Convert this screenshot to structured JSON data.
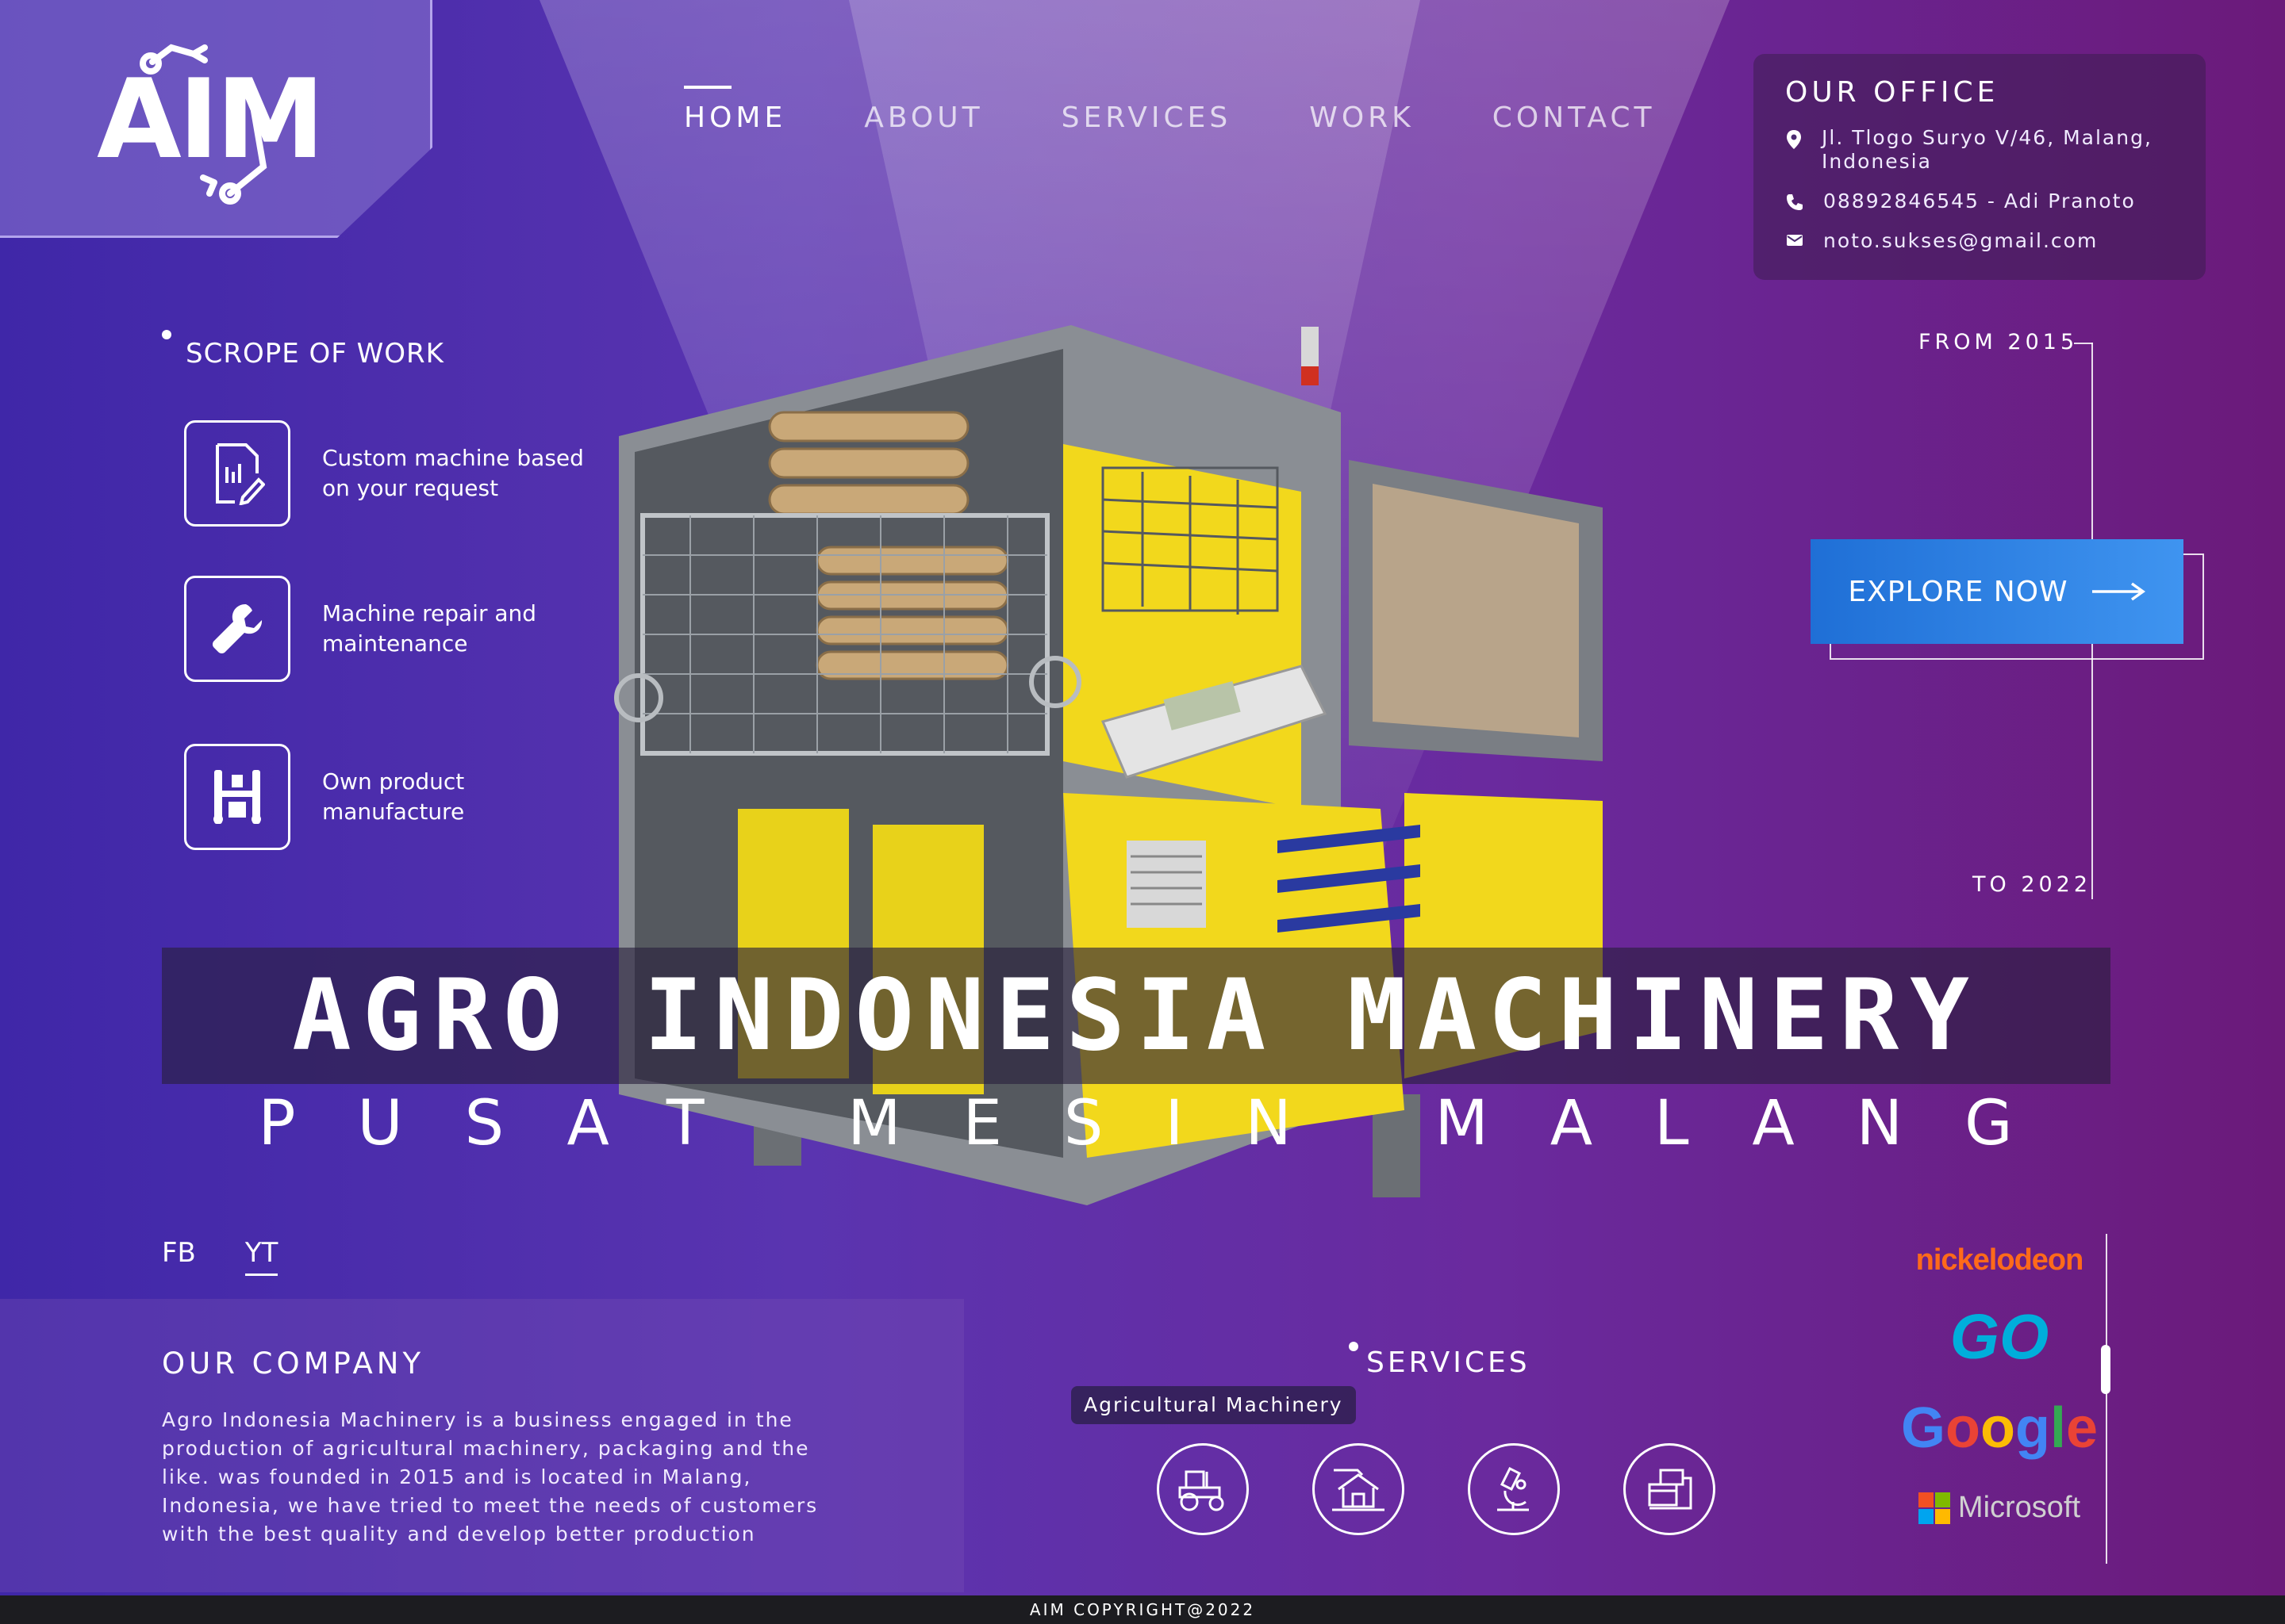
{
  "brand": {
    "logo_text": "AIM"
  },
  "nav": {
    "items": [
      {
        "label": "HOME",
        "active": true
      },
      {
        "label": "ABOUT",
        "active": false
      },
      {
        "label": "SERVICES",
        "active": false
      },
      {
        "label": "WORK",
        "active": false
      },
      {
        "label": "CONTACT",
        "active": false
      }
    ]
  },
  "office": {
    "title": "OUR OFFICE",
    "address": "Jl. Tlogo Suryo V/46, Malang, Indonesia",
    "phone": "08892846545 - Adi Pranoto",
    "email": "noto.sukses@gmail.com"
  },
  "scope": {
    "title": "SCROPE OF WORK",
    "items": [
      {
        "label": "Custom machine based on your request",
        "icon": "document-edit-icon"
      },
      {
        "label": "Machine repair and maintenance",
        "icon": "wrench-icon"
      },
      {
        "label": "Own product manufacture",
        "icon": "factory-icon"
      }
    ]
  },
  "timeline": {
    "from": "FROM 2015",
    "to": "TO 2022"
  },
  "cta": {
    "explore_label": "EXPLORE NOW"
  },
  "hero": {
    "headline": "AGRO INDONESIA MACHINERY",
    "subline": "PUSAT MESIN MALANG"
  },
  "social": {
    "fb": "FB",
    "yt": "YT"
  },
  "company": {
    "title": "OUR COMPANY",
    "text": "Agro Indonesia Machinery is a business engaged in the production of agricultural machinery, packaging and the like. was founded in 2015 and is located in Malang, Indonesia, we have tried to meet the needs of customers with the best quality and develop better production"
  },
  "services": {
    "title": "SERVICES",
    "tooltip": "Agricultural Machinery",
    "icons": [
      "tractor-icon",
      "house-building-icon",
      "microscope-icon",
      "packaging-icon"
    ]
  },
  "partners": {
    "items": [
      "nickelodeon",
      "GO",
      "Google",
      "Microsoft"
    ]
  },
  "footer": {
    "copyright": "AIM COPYRIGHT@2022"
  },
  "colors": {
    "accent": "#3f94f0",
    "bg_left": "#3f27a8",
    "bg_right": "#6b1a7a"
  }
}
